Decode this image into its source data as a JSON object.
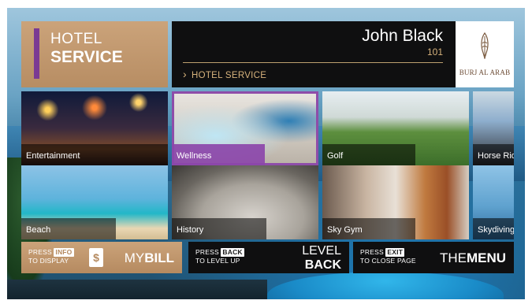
{
  "header": {
    "section_line1": "HOTEL",
    "section_line2": "SERVICE",
    "guest_name": "John Black",
    "room_number": "101",
    "breadcrumb": "HOTEL SERVICE",
    "logo_text": "BURJ AL ARAB"
  },
  "tiles": [
    {
      "label": "Entertainment"
    },
    {
      "label": "Wellness",
      "selected": true
    },
    {
      "label": "Golf"
    },
    {
      "label": "Horse Riding"
    },
    {
      "label": "Beach"
    },
    {
      "label": "History"
    },
    {
      "label": "Sky Gym"
    },
    {
      "label": "Skydiving"
    }
  ],
  "bottom_bar": {
    "bill": {
      "press": "PRESS",
      "key": "INFO",
      "hint": "TO DISPLAY",
      "label_light": "MY",
      "label_bold": "BILL",
      "icon_symbol": "$"
    },
    "back": {
      "press": "PRESS",
      "key": "BACK",
      "hint": "TO LEVEL UP",
      "label_line1": "LEVEL",
      "label_line2": "BACK"
    },
    "exit": {
      "press": "PRESS",
      "key": "EXIT",
      "hint": "TO CLOSE PAGE",
      "label_light": "THE",
      "label_bold": "MENU"
    }
  },
  "colors": {
    "accent_purple": "#7b3a93",
    "gold": "#cba37a",
    "gold_text": "#d6b27c",
    "panel_dark": "#0f0f10"
  },
  "icons": {
    "breadcrumb": "chevron-right-icon",
    "logo": "sail-logo-icon",
    "bill": "bill-icon"
  }
}
